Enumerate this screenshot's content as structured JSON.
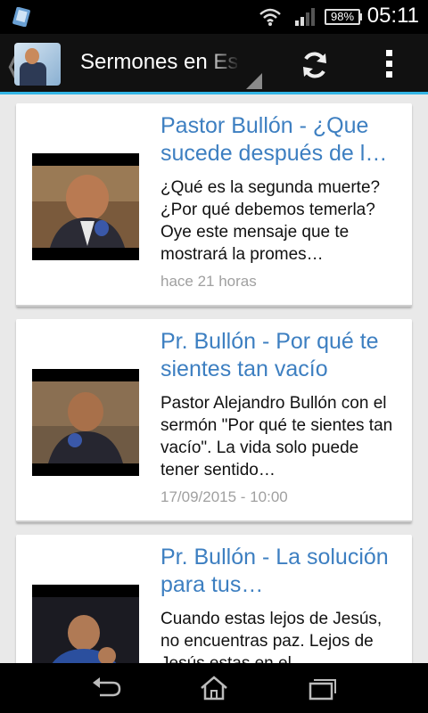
{
  "status_bar": {
    "battery": "98%",
    "time": "05:11"
  },
  "action_bar": {
    "title": "Sermones en Español"
  },
  "feed": {
    "items": [
      {
        "title": "Pastor Bullón - ¿Que sucede después de l…",
        "description": "¿Qué es la segunda muerte? ¿Por qué debemos temerla? Oye este mensaje que te mostrará la promes…",
        "date": "hace 21 horas"
      },
      {
        "title": "Pr. Bullón - Por qué te sientes tan vacío",
        "description": "Pastor Alejandro Bullón con el sermón \"Por qué te sientes tan vacío\". La vida solo puede tener sentido…",
        "date": "17/09/2015 - 10:00"
      },
      {
        "title": "Pr. Bullón - La solución para tus…",
        "description": "Cuando estas lejos de Jesús, no encuentras paz. Lejos de Jesús estas en el",
        "date": ""
      }
    ]
  },
  "colors": {
    "accent": "#33b5e5",
    "title_link": "#3d7fc1",
    "date_gray": "#a0a0a0"
  },
  "icons": [
    "app-icon",
    "wifi-icon",
    "signal-icon",
    "battery-icon",
    "back-chevron-icon",
    "refresh-icon",
    "overflow-menu-icon",
    "nav-back-icon",
    "nav-home-icon",
    "nav-recents-icon"
  ]
}
